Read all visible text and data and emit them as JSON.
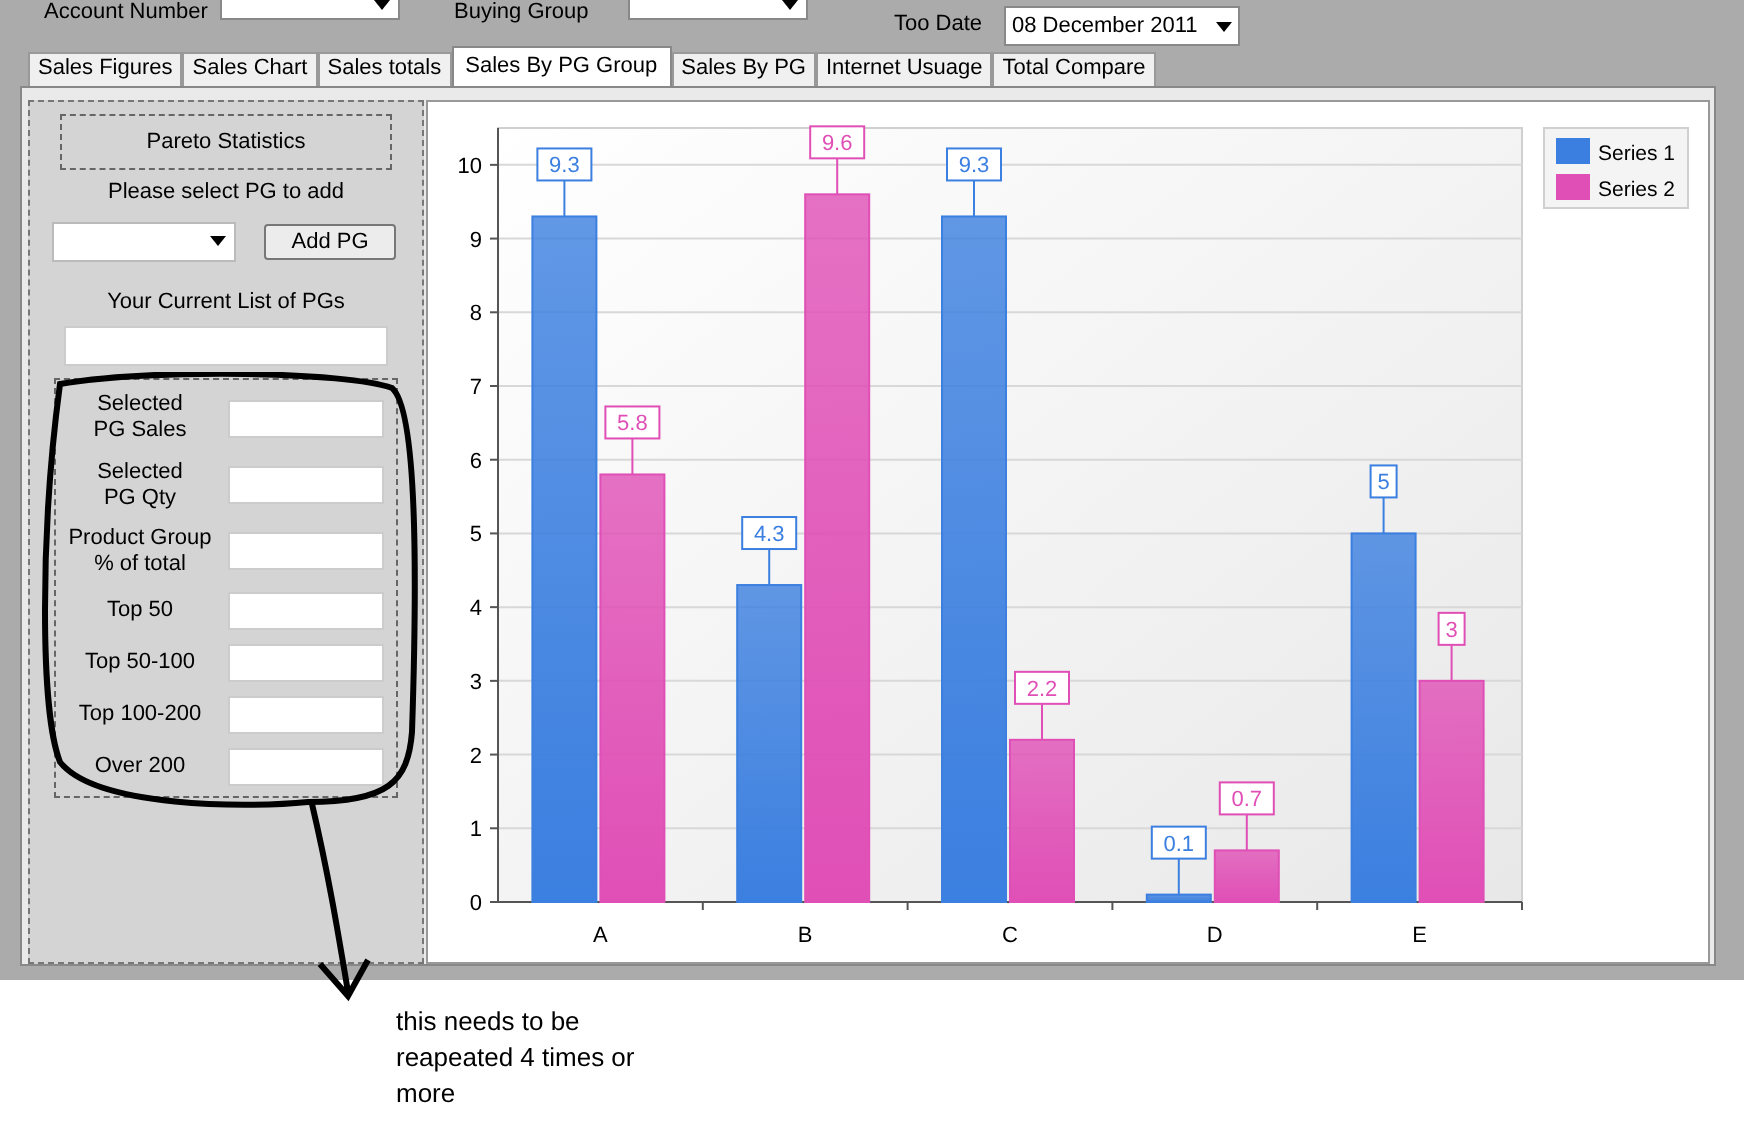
{
  "top_bar": {
    "fields": [
      {
        "label": "Account Number"
      },
      {
        "label": "Buying Group"
      }
    ],
    "date": {
      "label": "Too Date",
      "value": "08 December 2011"
    }
  },
  "tabs": [
    {
      "label": "Sales Figures",
      "selected": false
    },
    {
      "label": "Sales Chart",
      "selected": false
    },
    {
      "label": "Sales totals",
      "selected": false
    },
    {
      "label": "Sales By PG Group",
      "selected": true
    },
    {
      "label": "Sales By PG",
      "selected": false
    },
    {
      "label": "Internet Usuage",
      "selected": false
    },
    {
      "label": "Total Compare",
      "selected": false
    }
  ],
  "left_panel": {
    "title": "Pareto Statistics",
    "prompt": "Please select PG to add",
    "add_button": "Add PG",
    "list_label": "Your Current List of PGs",
    "stats": [
      {
        "lines": [
          "Selected",
          "PG Sales"
        ]
      },
      {
        "lines": [
          "Selected",
          "PG Qty"
        ]
      },
      {
        "lines": [
          "Product Group",
          "% of total"
        ]
      },
      {
        "lines": [
          "Top 50"
        ]
      },
      {
        "lines": [
          "Top 50-100"
        ]
      },
      {
        "lines": [
          "Top 100-200"
        ]
      },
      {
        "lines": [
          "Over 200"
        ]
      }
    ]
  },
  "chart_data": {
    "type": "bar",
    "categories": [
      "A",
      "B",
      "C",
      "D",
      "E"
    ],
    "ylim": [
      0,
      10.5
    ],
    "yticks": [
      0,
      1,
      2,
      3,
      4,
      5,
      6,
      7,
      8,
      9,
      10
    ],
    "data_labels": true,
    "grid": true,
    "legend": "top-right",
    "series": [
      {
        "name": "Series 1",
        "color": "#3b7fe0",
        "values": [
          9.3,
          4.3,
          9.3,
          0.1,
          5
        ]
      },
      {
        "name": "Series 2",
        "color": "#e04fb6",
        "values": [
          5.8,
          9.6,
          2.2,
          0.7,
          3
        ]
      }
    ]
  },
  "annotation": "this needs to be reapeated 4 times or more"
}
